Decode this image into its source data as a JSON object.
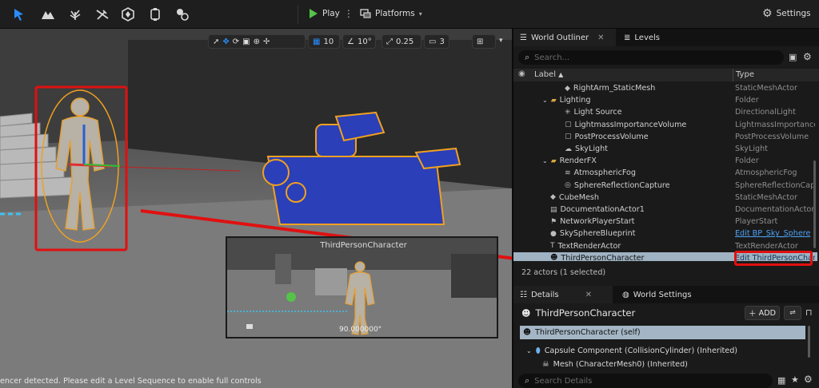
{
  "toolbar": {
    "play_label": "Play",
    "platforms_label": "Platforms",
    "settings_label": "Settings"
  },
  "viewport": {
    "grid_snap": "10",
    "rotation_snap": "10°",
    "scale_snap": "0.25",
    "camera_speed": "3",
    "pip_title": "ThirdPersonCharacter",
    "pip_rotation": "90.000000°",
    "status_message": "encer detected. Please edit a Level Sequence to enable full controls"
  },
  "outliner": {
    "tab_label": "World Outliner",
    "levels_tab_label": "Levels",
    "search_placeholder": "Search...",
    "col_label": "Label",
    "col_type": "Type",
    "rows": [
      {
        "label": "RightArm_StaticMesh",
        "type": "StaticMeshActor",
        "indent": 3,
        "icon": "mesh-icon"
      },
      {
        "label": "Lighting",
        "type": "Folder",
        "indent": 2,
        "icon": "folder-icon"
      },
      {
        "label": "Light Source",
        "type": "DirectionalLight",
        "indent": 3,
        "icon": "light-icon"
      },
      {
        "label": "LightmassImportanceVolume",
        "type": "LightmassImportance",
        "indent": 3,
        "icon": "volume-icon"
      },
      {
        "label": "PostProcessVolume",
        "type": "PostProcessVolume",
        "indent": 3,
        "icon": "volume-icon"
      },
      {
        "label": "SkyLight",
        "type": "SkyLight",
        "indent": 3,
        "icon": "skylight-icon"
      },
      {
        "label": "RenderFX",
        "type": "Folder",
        "indent": 2,
        "icon": "folder-icon"
      },
      {
        "label": "AtmosphericFog",
        "type": "AtmosphericFog",
        "indent": 3,
        "icon": "fog-icon"
      },
      {
        "label": "SphereReflectionCapture",
        "type": "SphereReflectionCapt",
        "indent": 3,
        "icon": "reflection-icon"
      },
      {
        "label": "CubeMesh",
        "type": "StaticMeshActor",
        "indent": 2,
        "icon": "mesh-icon"
      },
      {
        "label": "DocumentationActor1",
        "type": "DocumentationActor",
        "indent": 2,
        "icon": "doc-icon"
      },
      {
        "label": "NetworkPlayerStart",
        "type": "PlayerStart",
        "indent": 2,
        "icon": "playerstart-icon"
      },
      {
        "label": "SkySphereBlueprint",
        "type": "Edit BP_Sky_Sphere",
        "indent": 2,
        "icon": "sphere-icon"
      },
      {
        "label": "TextRenderActor",
        "type": "TextRenderActor",
        "indent": 2,
        "icon": "text-icon"
      },
      {
        "label": "ThirdPersonCharacter",
        "type": "Edit ThirdPersonChar",
        "indent": 2,
        "icon": "pawn-icon"
      }
    ],
    "actor_count": "22 actors (1 selected)"
  },
  "details": {
    "tab_label": "Details",
    "world_settings_tab_label": "World Settings",
    "actor_name": "ThirdPersonCharacter",
    "add_label": "ADD",
    "self_label": "ThirdPersonCharacter (self)",
    "capsule_label": "Capsule Component (CollisionCylinder) (Inherited)",
    "mesh_label": "Mesh (CharacterMesh0) (Inherited)",
    "search_placeholder": "Search Details"
  },
  "colors": {
    "accent_blue": "#2a7fd4",
    "selected_row": "#9fb3c3",
    "highlight_red": "#e01010",
    "play_green": "#55c24a",
    "link_blue": "#4ea3f5"
  }
}
